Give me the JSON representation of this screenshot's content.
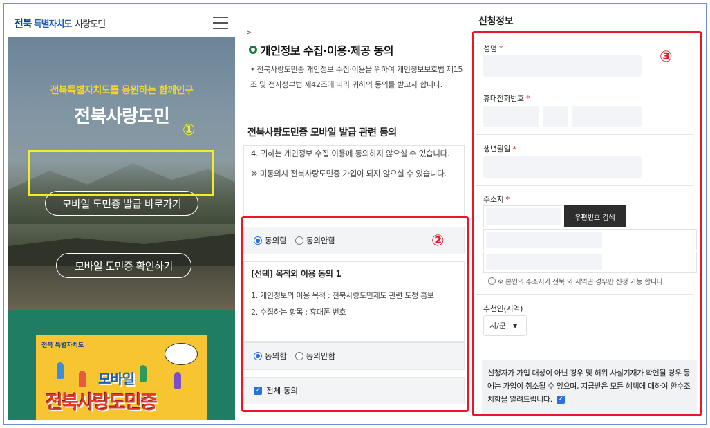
{
  "panel1": {
    "logo_main": "전북",
    "logo_sub": "특별자치도",
    "logo_tag": "사랑도민",
    "hero_subtitle": "전북특별자치도를 응원하는 함께인구",
    "hero_title": "전북사랑도민",
    "issue_button": "모바일 도민증 발급 바로가기",
    "check_button": "모바일 도민증 확인하기",
    "poster_logo": "전북 특별자치도",
    "poster_mobile": "모바일",
    "poster_big": "전북사랑도민증",
    "marker": "①"
  },
  "panel2": {
    "breadcrumb_arrow": ">",
    "section_title": "개인정보 수집·이용·제공 동의",
    "intro": "• 전북사랑도민증 개인정보 수집·이용을 위하여 개인정보보호법 제15조 및 전자정부법 제42조에 따라 귀하의 동의를 받고자 합니다.",
    "subsection_title": "전북사랑도민증 모바일 발급 관련 동의",
    "scroll_line1": "4. 귀하는 개인정보 수집·이용에 동의하지 않으실 수 있습니다.",
    "scroll_line2": "※ 미동의시 전북사랑도민증 가입이 되지 않으실 수 있습니다.",
    "agree_label": "동의함",
    "disagree_label": "동의안함",
    "optional_title": "[선택] 목적외 이용 동의 1",
    "optional_line1": "1. 개인정보의 이용 목적 : 전북사랑도민제도 관련 도정 홍보",
    "optional_line2": "2. 수집하는 항목 : 휴대폰 번호",
    "agree_all": "전체 동의",
    "marker": "②"
  },
  "panel3": {
    "title": "신청정보",
    "name_label": "성명",
    "phone_label": "휴대전화번호",
    "birth_label": "생년월일",
    "address_label": "주소지",
    "required_mark": "*",
    "zip_button": "우편번호 검색",
    "address_note": "※ 본인의 주소지가 전북 외 지역일 경우만 신청 가능 합니다.",
    "recommender_label": "추천인(지역)",
    "recommender_select": "시/군",
    "disclaimer": "신청자가 가입 대상이 아닌 경우 및 허위 사실기재가 확인될 경우 등에는 가입이 취소될 수 있으며, 지급받은 모든 혜택에 대하여 환수조치함을 알려드립니다.",
    "marker": "③"
  },
  "colors": {
    "annotation_red": "#e8182a",
    "annotation_yellow": "#f4ec27",
    "radio_blue": "#2a6fdb",
    "title_green": "#1a7a3c"
  }
}
